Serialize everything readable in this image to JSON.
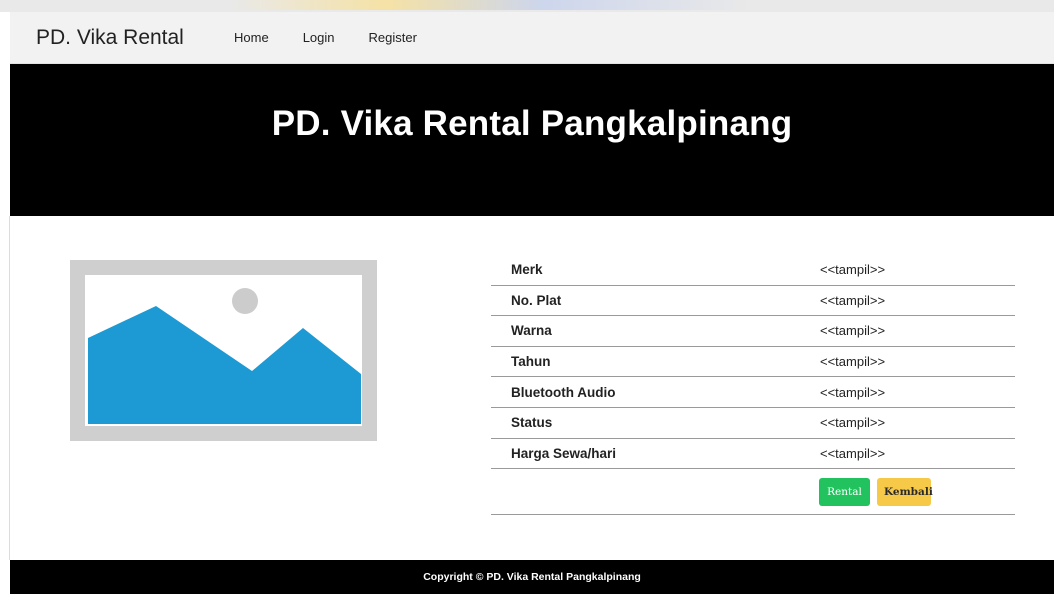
{
  "navbar": {
    "brand": "PD. Vika Rental",
    "links": [
      "Home",
      "Login",
      "Register"
    ]
  },
  "hero": {
    "title": "PD. Vika Rental Pangkalpinang"
  },
  "image": {
    "icon": "image-placeholder-icon",
    "colors": {
      "frame": "#cfcfcf",
      "mountain": "#1d99d3",
      "sun": "#cccccc"
    }
  },
  "specs": [
    {
      "label": "Merk",
      "value": "<<tampil>>"
    },
    {
      "label": "No. Plat",
      "value": "<<tampil>>"
    },
    {
      "label": "Warna",
      "value": "<<tampil>>"
    },
    {
      "label": "Tahun",
      "value": "<<tampil>>"
    },
    {
      "label": "Bluetooth Audio",
      "value": "<<tampil>>"
    },
    {
      "label": "Status",
      "value": "<<tampil>>"
    },
    {
      "label": "Harga Sewa/hari",
      "value": "<<tampil>>"
    }
  ],
  "actions": {
    "rental_label": "Rental",
    "kembali_label": "Kembali",
    "rental_color": "#22c35e",
    "kembali_color": "#f7c948"
  },
  "footer": {
    "copyright": "Copyright © PD. Vika Rental Pangkalpinang"
  }
}
